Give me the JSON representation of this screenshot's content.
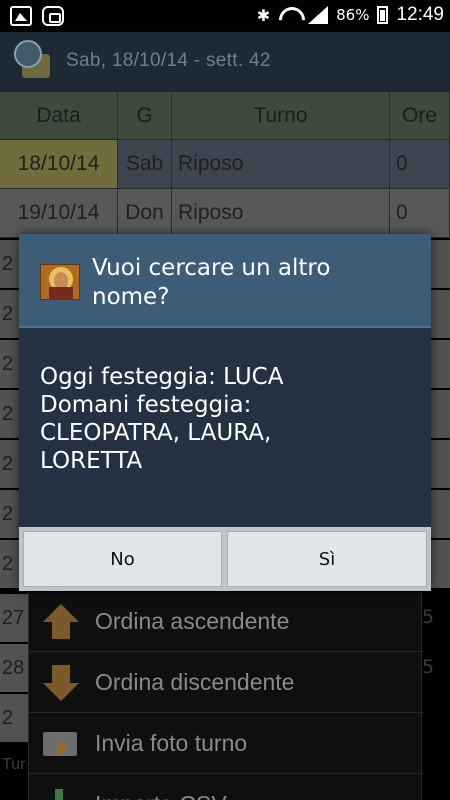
{
  "status_bar": {
    "battery": "86%",
    "time": "12:49",
    "icons": [
      "image-icon",
      "bbm-icon",
      "bluetooth-icon",
      "wifi-icon",
      "signal-icon",
      "battery-icon"
    ]
  },
  "action_bar": {
    "title": "Sab, 18/10/14 - sett. 42"
  },
  "table": {
    "headers": [
      "Data",
      "G",
      "Turno",
      "Ore"
    ],
    "rows": [
      [
        "18/10/14",
        "Sab",
        "Riposo",
        "0"
      ],
      [
        "19/10/14",
        "Don",
        "Riposo",
        "0"
      ]
    ],
    "stub_first_chars": [
      "2",
      "2",
      "2",
      "2",
      "2",
      "2",
      "2"
    ],
    "stub_rows_partial": [
      "27",
      "28",
      "2"
    ],
    "stub_right": [
      "5",
      "5"
    ]
  },
  "bottom_left": "Tur",
  "menu": {
    "items": [
      {
        "label": "Ordina ascendente",
        "icon": "arrow-up-icon"
      },
      {
        "label": "Ordina discendente",
        "icon": "arrow-down-icon"
      },
      {
        "label": "Invia foto turno",
        "icon": "send-photo-icon"
      },
      {
        "label": "Importa CSV",
        "icon": "download-icon"
      }
    ]
  },
  "dialog": {
    "title": "Vuoi cercare un altro nome?",
    "message": "Oggi festeggia: LUCA\nDomani festeggia:\nCLEOPATRA, LAURA,\nLORETTA",
    "btn_no": "No",
    "btn_si": "Sì"
  }
}
